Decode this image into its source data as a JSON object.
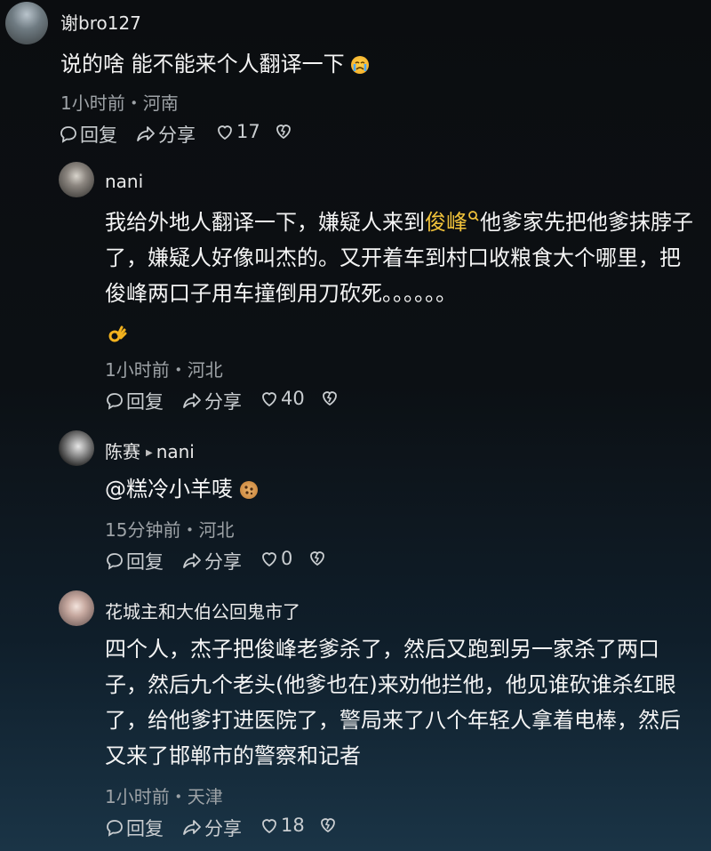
{
  "comments": [
    {
      "user": "谢bro127",
      "text": "说的啥 能不能来个人翻译一下",
      "emoji": "crying-emoji",
      "meta": "1小时前・河南",
      "reply_label": "回复",
      "share_label": "分享",
      "likes": "17"
    },
    {
      "user": "nani",
      "text_before": "我给外地人翻译一下，嫌疑人来到",
      "link_text": "俊峰",
      "text_after": "他爹家先把他爹抹脖子了，嫌疑人好像叫杰的。又开着车到村口收粮食大个哪里，把俊峰两口子用车撞倒用刀砍死。。。。。。",
      "emoji": "ok-hand-emoji",
      "meta": "1小时前・河北",
      "reply_label": "回复",
      "share_label": "分享",
      "likes": "40"
    },
    {
      "user": "陈赛",
      "reply_to": "nani",
      "text": "@糕冷小羊唛",
      "emoji": "cookie-emoji",
      "meta": "15分钟前・河北",
      "reply_label": "回复",
      "share_label": "分享",
      "likes": "0"
    },
    {
      "user": "花城主和大伯公回鬼市了",
      "text": "四个人，杰子把俊峰老爹杀了，然后又跑到另一家杀了两口子，然后九个老头(他爹也在)来劝他拦他，他见谁砍谁杀红眼了，给他爹打进医院了，警局来了八个年轻人拿着电棒，然后又来了邯郸市的警察和记者",
      "meta": "1小时前・天津",
      "reply_label": "回复",
      "share_label": "分享",
      "likes": "18"
    }
  ],
  "colors": {
    "highlight": "#f0c23a",
    "meta": "#9ea3a7",
    "text": "#f4f4f4"
  }
}
